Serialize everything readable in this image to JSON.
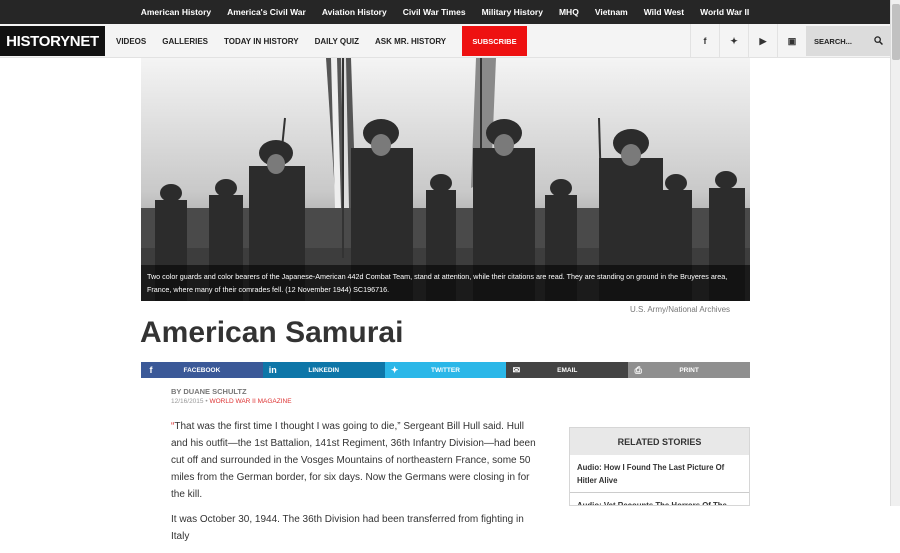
{
  "topnav": [
    "American History",
    "America's Civil War",
    "Aviation History",
    "Civil War Times",
    "Military History",
    "MHQ",
    "Vietnam",
    "Wild West",
    "World War II"
  ],
  "logo": "HISTORYNET",
  "mainnav": [
    "VIDEOS",
    "GALLERIES",
    "TODAY IN HISTORY",
    "DAILY QUIZ",
    "ASK MR. HISTORY"
  ],
  "subscribe": "SUBSCRIBE",
  "social_icons": [
    "facebook-icon",
    "twitter-icon",
    "youtube-icon",
    "instagram-icon"
  ],
  "social_glyphs": [
    "f",
    "✦",
    "▶",
    "▣"
  ],
  "search": {
    "placeholder": "SEARCH..."
  },
  "hero": {
    "caption": "Two color guards and color bearers of the Japanese-American 442d Combat Team, stand at attention, while their citations are read. They are standing on ground in the Bruyeres area, France, where many of their comrades fell. (12 November 1944) SC196716.",
    "credit": "U.S. Army/National Archives"
  },
  "article": {
    "title": "American Samurai",
    "byline": "BY DUANE SCHULTZ",
    "date": "12/16/2015",
    "sep": " • ",
    "magazine": "WORLD WAR II MAGAZINE",
    "paragraph1": "“That was the first time I thought I was going to die,” Sergeant Bill Hull said. Hull and his outfit—the 1st Battalion, 141st Regiment, 36th Infantry Division—had been cut off and surrounded in the Vosges Mountains of northeastern France, some 50 miles from the German border, for six days. Now the Germans were closing in for the kill.",
    "paragraph2": "It was October 30, 1944. The 36th Division had been transferred from fighting in Italy"
  },
  "share": [
    {
      "label": "FACEBOOK",
      "icon": "facebook-icon",
      "glyph": "f",
      "color": "#3b5998"
    },
    {
      "label": "LINKEDIN",
      "icon": "linkedin-icon",
      "glyph": "in",
      "color": "#0e76a8"
    },
    {
      "label": "TWITTER",
      "icon": "twitter-icon",
      "glyph": "✦",
      "color": "#2bb7e8"
    },
    {
      "label": "EMAIL",
      "icon": "email-icon",
      "glyph": "✉",
      "color": "#444444"
    },
    {
      "label": "PRINT",
      "icon": "print-icon",
      "glyph": "⎙",
      "color": "#8f8f8f"
    }
  ],
  "related": {
    "heading": "RELATED STORIES",
    "items": [
      "Audio: How I Found The Last Picture Of Hitler Alive",
      "Audio: Vet Recounts The Horrors Of The"
    ]
  }
}
